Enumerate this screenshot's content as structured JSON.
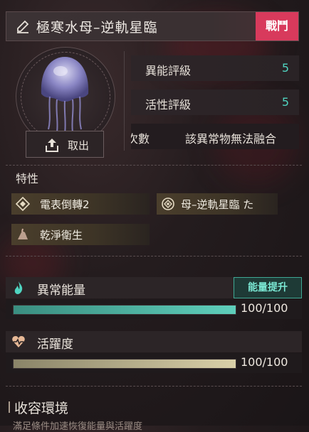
{
  "header": {
    "title": "極寒水母–逆軌星臨",
    "badge": "戰鬥",
    "icons": {
      "edit": "pencil-icon"
    }
  },
  "portrait": {
    "extract_label": "取出",
    "extract_icon": "upload-icon"
  },
  "stats": [
    {
      "label": "異能評級",
      "value": "5"
    },
    {
      "label": "活性評級",
      "value": "5"
    }
  ],
  "fusion": {
    "label_partial": "次數",
    "value": "該異常物無法融合"
  },
  "traits": {
    "title": "特性",
    "items": [
      {
        "label": "電表倒轉2",
        "icon": "diamond-icon"
      },
      {
        "label": "母–逆軌星臨  た",
        "icon": "target-icon"
      },
      {
        "label": "乾淨衛生",
        "icon": "broom-icon"
      }
    ]
  },
  "energy": {
    "label": "異常能量",
    "icon": "flame-icon",
    "button": "能量提升",
    "value_text": "100/100",
    "fraction": 1.0,
    "color": "#5ecfbb"
  },
  "activity": {
    "label": "活躍度",
    "icon": "heartbeat-icon",
    "value_text": "100/100",
    "fraction": 1.0,
    "color": "#d9d0a8"
  },
  "environment": {
    "title": "收容環境",
    "subtitle": "滿足條件加速恢復能量與活躍度"
  },
  "colors": {
    "accent_teal": "#4fd4c0",
    "badge_red": "#d83a5c"
  }
}
